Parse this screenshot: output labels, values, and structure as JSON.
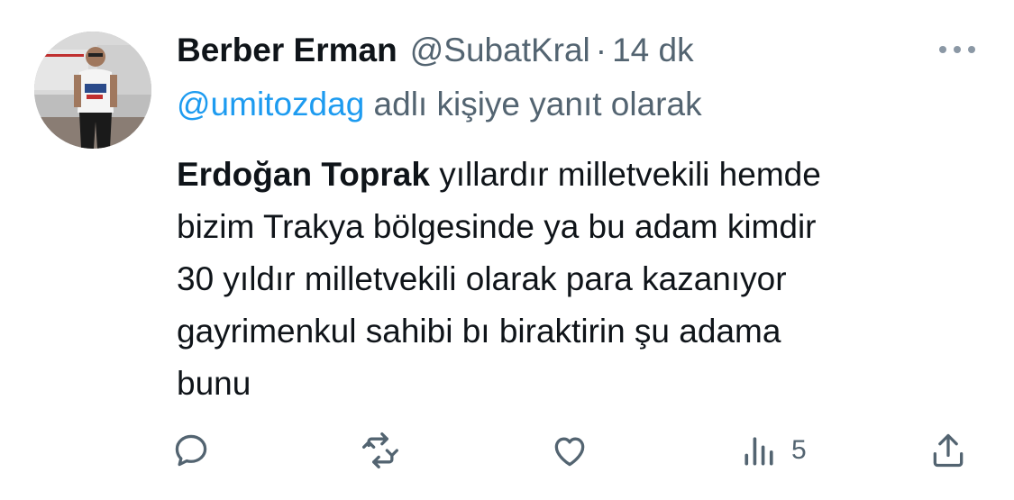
{
  "tweet": {
    "author": {
      "name": "Berber Erman",
      "handle": "@SubatKral",
      "separator": "·",
      "time": "14 dk"
    },
    "reply_to": {
      "mention": "@umitozdag",
      "suffix": " adlı kişiye yanıt olarak"
    },
    "text": {
      "bold_name": "Erdoğan Toprak",
      "line1_rest": " yıllardır milletvekili hemde",
      "line2": "bizim Trakya bölgesinde ya bu adam kimdir",
      "line3": "30 yıldır milletvekili olarak para kazanıyor",
      "line4": "gayrimenkul sahibi bı biraktirin şu adama",
      "line5": "bunu"
    },
    "actions": {
      "reply_icon": "reply-icon",
      "retweet_icon": "retweet-icon",
      "like_icon": "like-icon",
      "views_icon": "views-icon",
      "views_count": "5",
      "share_icon": "share-icon"
    }
  },
  "colors": {
    "text": "#0f1419",
    "secondary": "#536471",
    "link": "#1d9bf0"
  }
}
